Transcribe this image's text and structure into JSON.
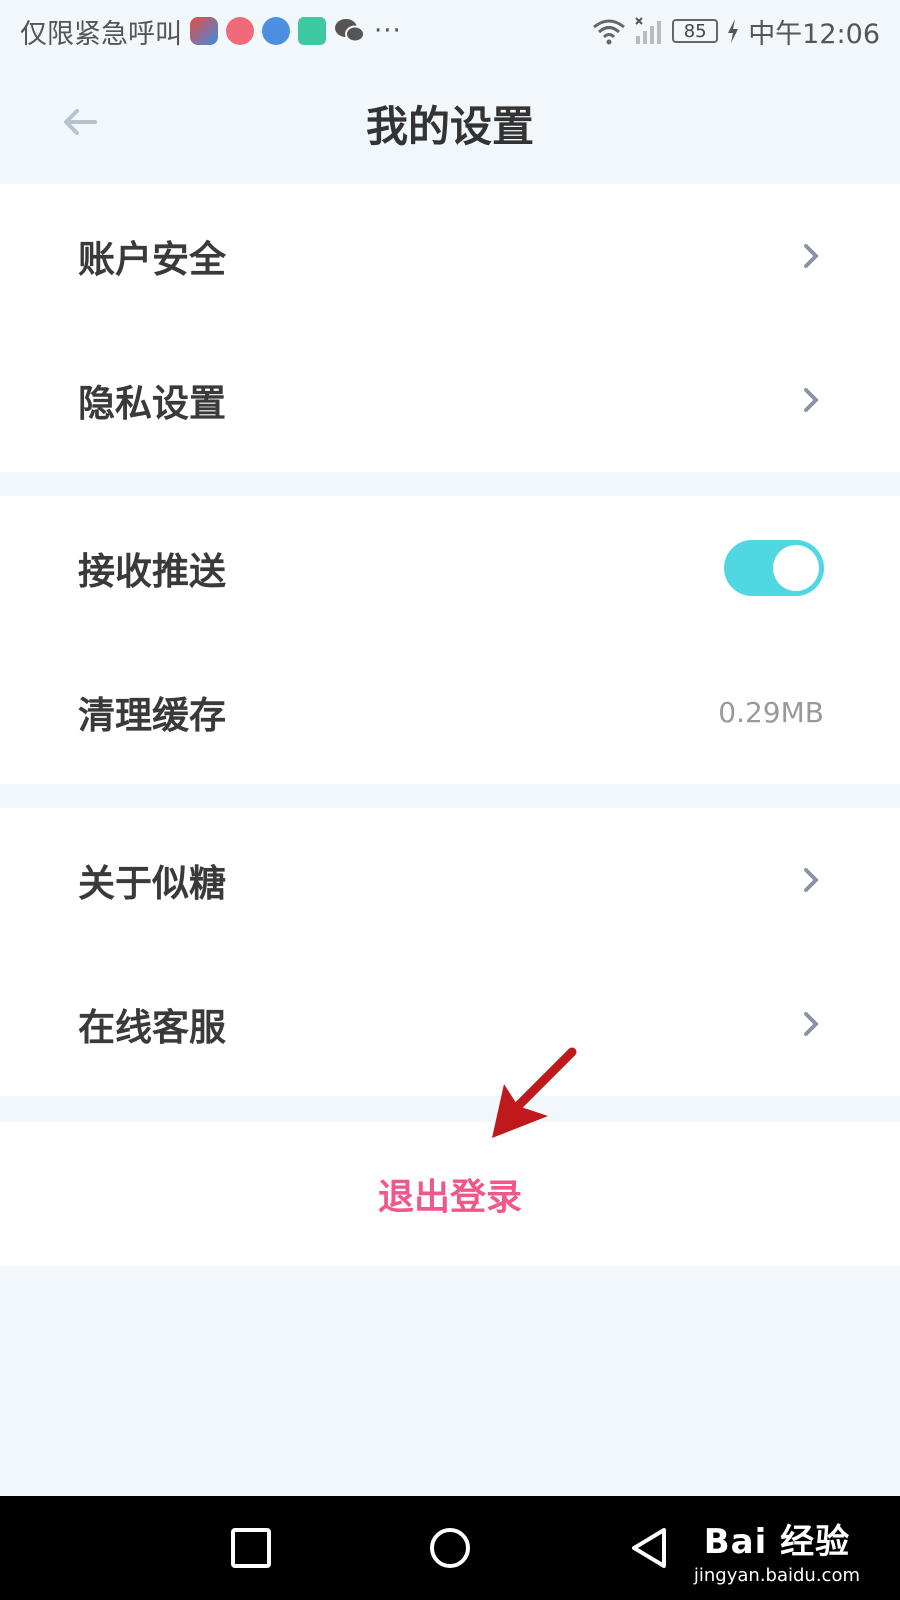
{
  "statusbar": {
    "carrier": "仅限紧急呼叫",
    "overflow": "···",
    "battery": "85",
    "time": "中午12:06",
    "icons": [
      "app-icon-1",
      "app-icon-2",
      "browser-icon",
      "app-icon-4",
      "wechat-icon",
      "wifi-icon",
      "signal-icon",
      "charging-icon"
    ]
  },
  "header": {
    "title": "我的设置",
    "back_icon": "back-arrow-icon"
  },
  "groups": {
    "account": {
      "security": "账户安全",
      "privacy": "隐私设置"
    },
    "system": {
      "push": "接收推送",
      "push_enabled": true,
      "cache": "清理缓存",
      "cache_size": "0.29MB"
    },
    "about": {
      "about": "关于似糖",
      "service": "在线客服"
    }
  },
  "logout": {
    "label": "退出登录"
  },
  "watermark": {
    "logo": "Bai 经验",
    "url": "jingyan.baidu.com"
  },
  "colors": {
    "accent": "#4fd8e2",
    "logout": "#f0578a",
    "background": "#f1f7fb",
    "annotation": "#c0191b"
  }
}
